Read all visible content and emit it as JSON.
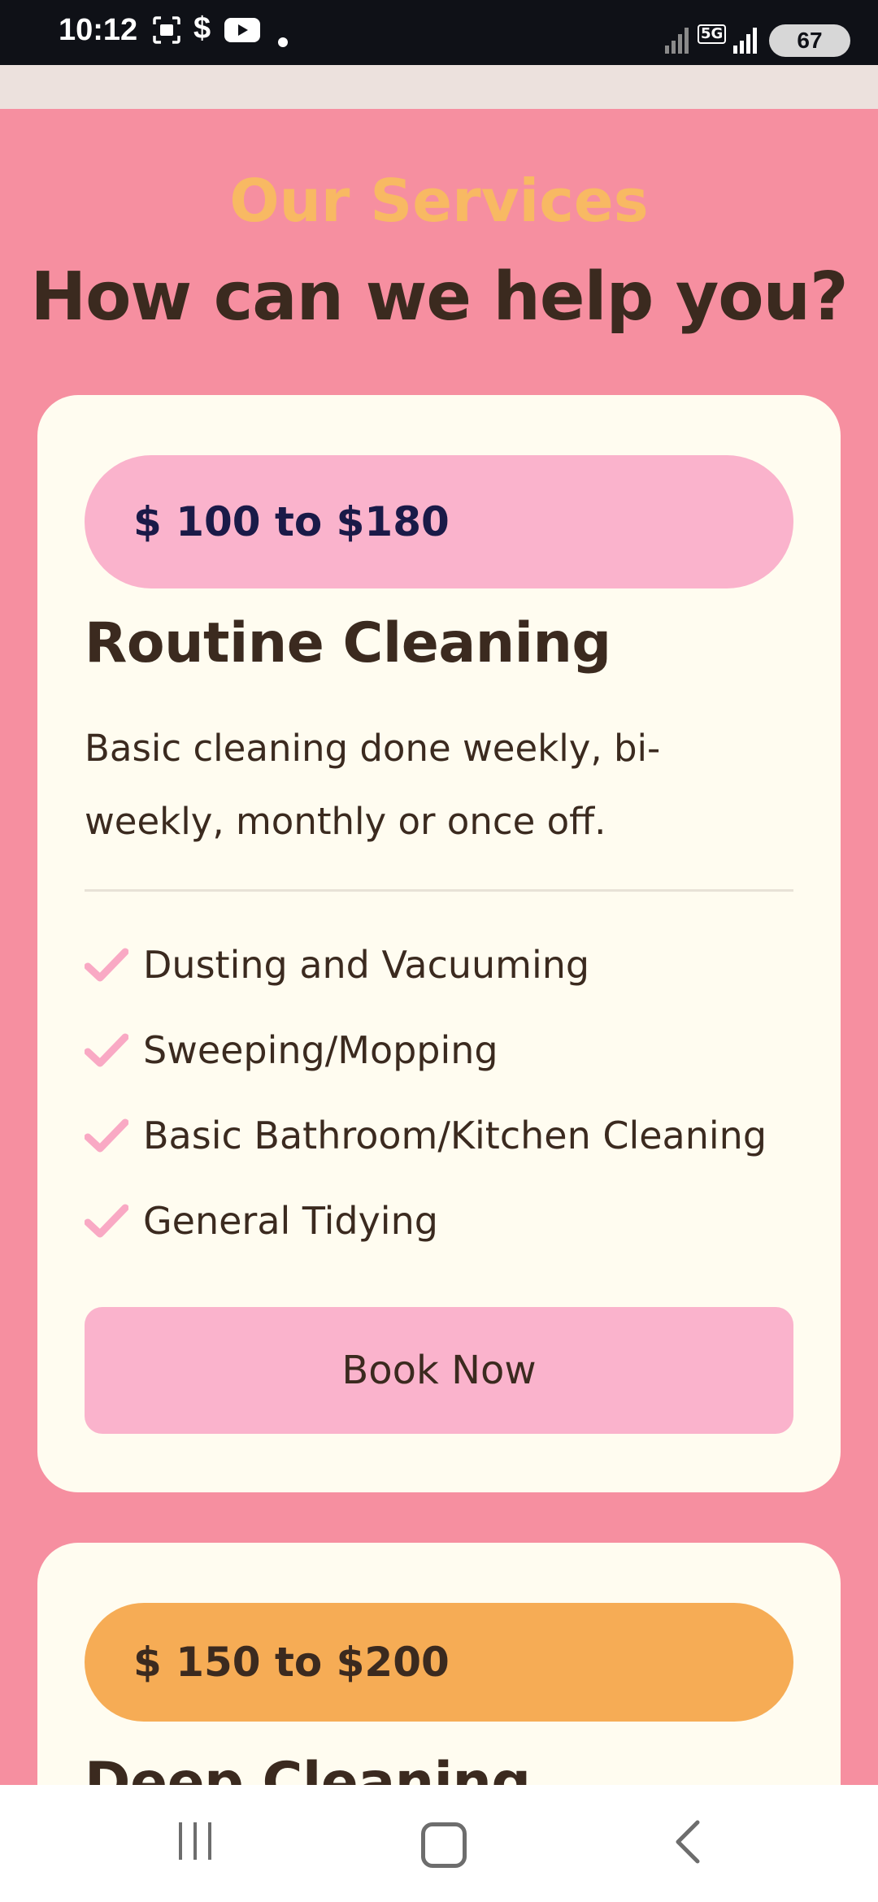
{
  "status_bar": {
    "time": "10:12",
    "dollar_icon_text": "$",
    "network_label": "5G",
    "battery": "67"
  },
  "section": {
    "eyebrow": "Our Services",
    "heading": "How can we help you?"
  },
  "services": [
    {
      "price": "$ 100 to $180",
      "title": "Routine Cleaning",
      "description": "Basic cleaning done weekly, bi-weekly, monthly or once off.",
      "features": [
        "Dusting and Vacuuming",
        "Sweeping/Mopping",
        "Basic Bathroom/Kitchen Cleaning",
        "General Tidying"
      ],
      "button_label": "Book Now"
    },
    {
      "price": "$ 150 to $200",
      "title": "Deep Cleaning"
    }
  ],
  "colors": {
    "page_bg": "#f68fa0",
    "card_bg": "#fffcf0",
    "accent_pink": "#fab3cc",
    "accent_orange": "#f6ac55",
    "eyebrow": "#f8b963",
    "text_dark": "#3b2a1f"
  },
  "icons": {
    "feature": "check-icon",
    "nav_recent": "recent-apps-icon",
    "nav_home": "home-icon",
    "nav_back": "back-icon"
  }
}
